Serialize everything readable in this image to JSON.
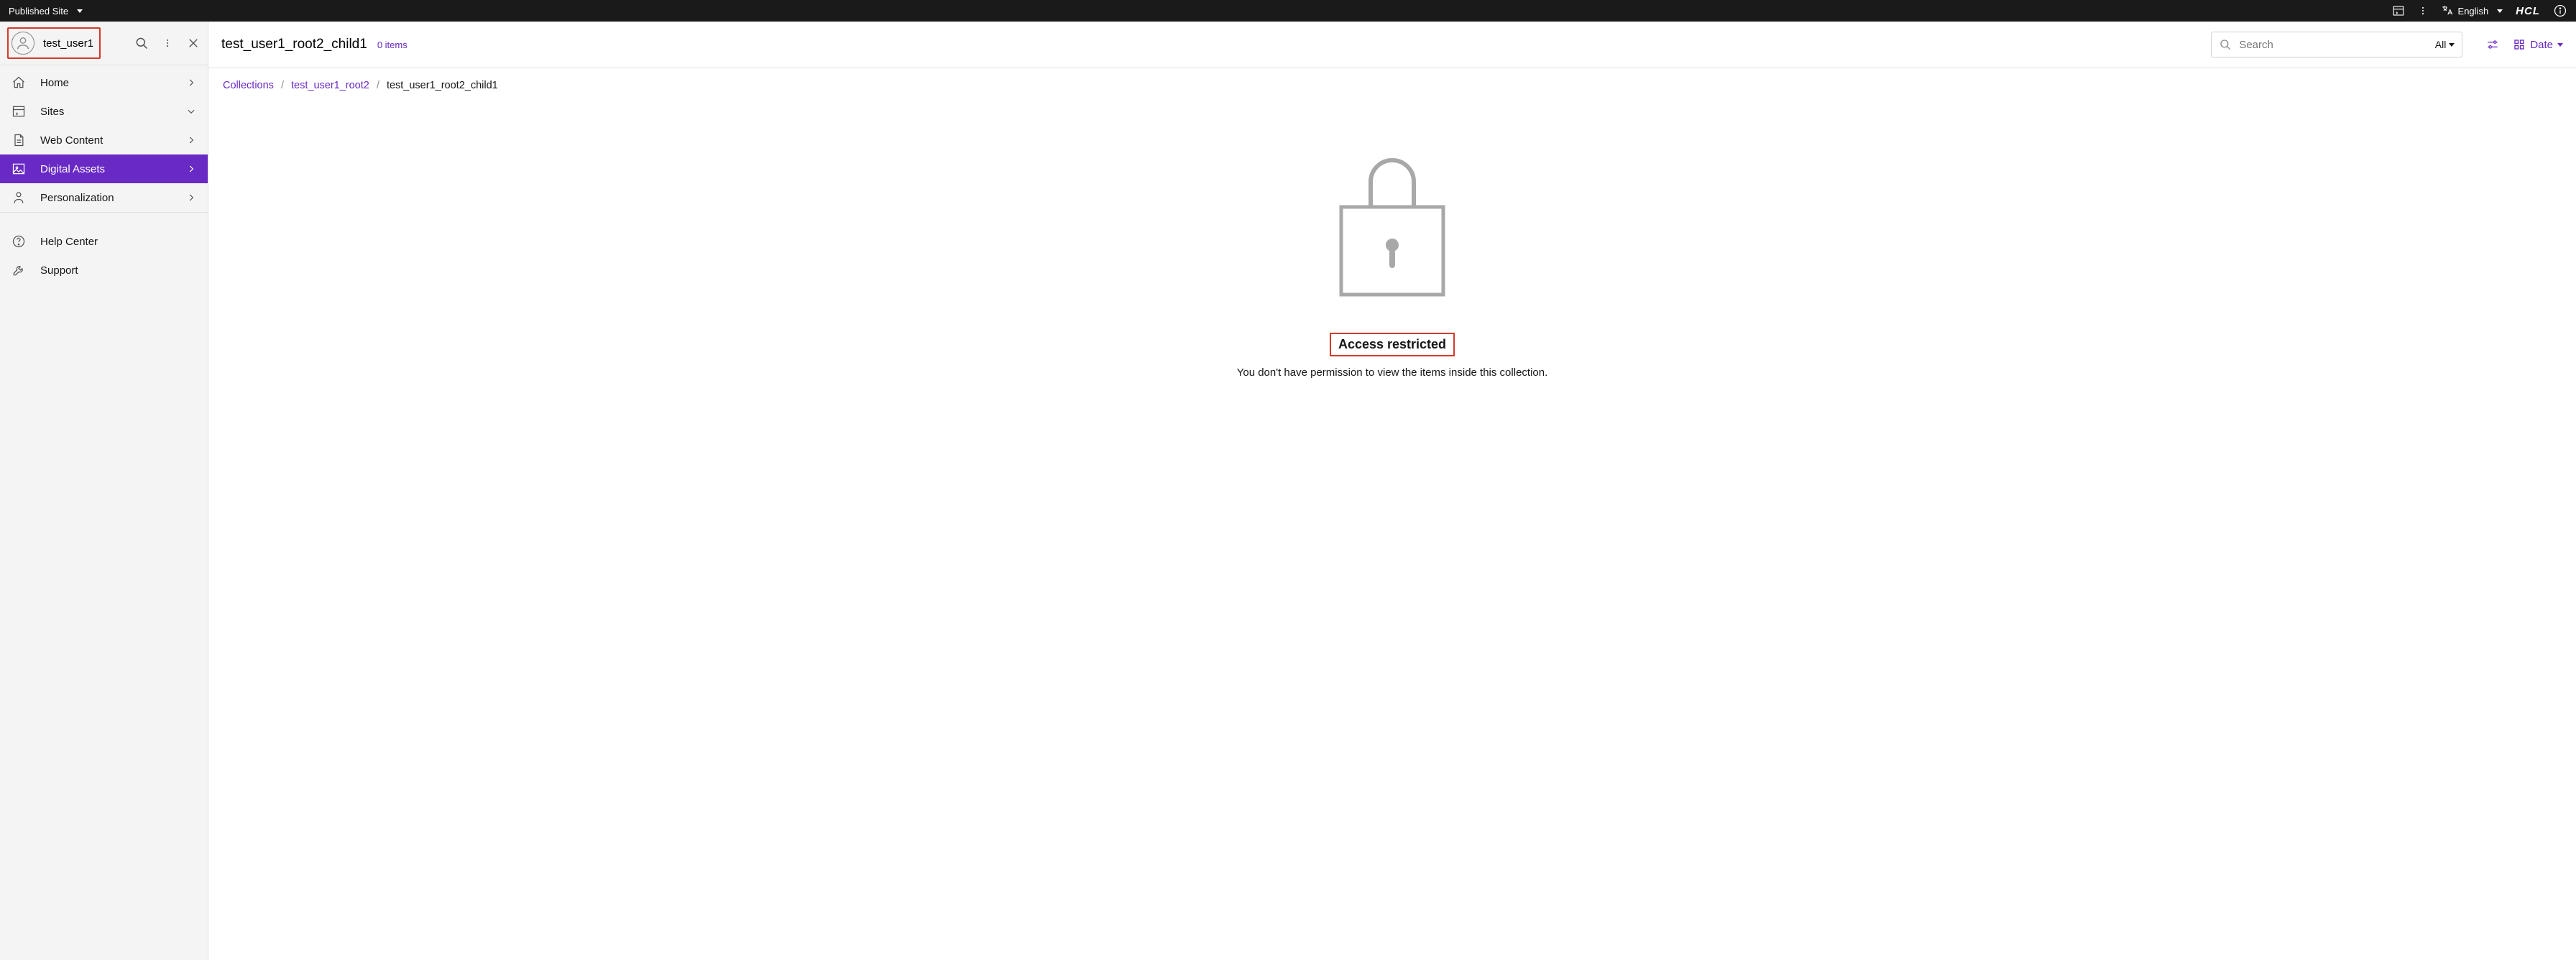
{
  "topbar": {
    "site_label": "Published Site",
    "language_label": "English",
    "brand": "HCL"
  },
  "sidebar": {
    "user_name": "test_user1",
    "nav": [
      {
        "label": "Home"
      },
      {
        "label": "Sites"
      },
      {
        "label": "Web Content"
      },
      {
        "label": "Digital Assets"
      },
      {
        "label": "Personalization"
      }
    ],
    "nav2": [
      {
        "label": "Help Center"
      },
      {
        "label": "Support"
      }
    ]
  },
  "main": {
    "title": "test_user1_root2_child1",
    "item_count": "0 items",
    "search_placeholder": "Search",
    "search_scope": "All",
    "sort_label": "Date"
  },
  "breadcrumb": {
    "root": "Collections",
    "parent": "test_user1_root2",
    "current": "test_user1_root2_child1"
  },
  "restricted": {
    "title": "Access restricted",
    "message": "You don't have permission to view the items inside this collection."
  }
}
